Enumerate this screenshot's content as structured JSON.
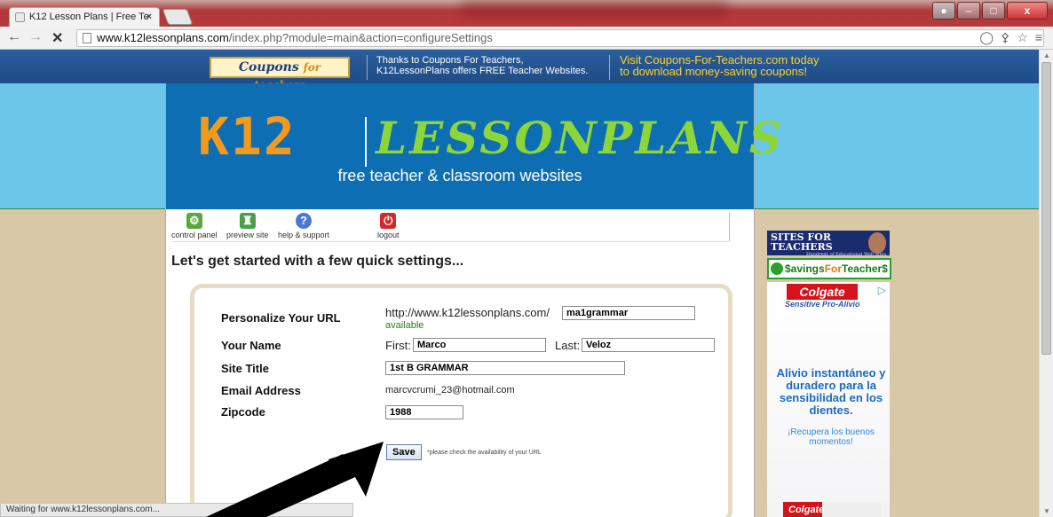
{
  "browser": {
    "tab_title": "K12 Lesson Plans | Free Te",
    "tab_close": "×",
    "url_host": "www.k12lessonplans.com",
    "url_path": "/index.php?module=main&action=configureSettings",
    "status_text": "Waiting for www.k12lessonplans.com..."
  },
  "topbar": {
    "coupon_logo_word1": "Coupons",
    "coupon_logo_word2": "for teachers",
    "message_line1": "Thanks to Coupons For Teachers,",
    "message_line2": "K12LessonPlans offers FREE Teacher Websites.",
    "promo_line1": "Visit Coupons-For-Teachers.com today",
    "promo_line2": "to download money-saving coupons!"
  },
  "banner": {
    "logo_k12": "K12",
    "logo_lessonplans": "LESSONPLANS",
    "tagline": "free teacher & classroom websites"
  },
  "nav": {
    "control_panel": "control panel",
    "preview_site": "preview site",
    "help_support": "help & support",
    "logout": "logout"
  },
  "heading": "Let's get started with a few quick settings...",
  "form": {
    "url_label": "Personalize Your URL",
    "url_prefix": "http://www.k12lessonplans.com/",
    "url_value": "ma1grammar",
    "url_status": "available",
    "name_label": "Your Name",
    "first_label": "First:",
    "first_value": "Marco",
    "last_label": "Last:",
    "last_value": "Veloz",
    "title_label": "Site Title",
    "title_value": "1st B GRAMMAR",
    "email_label": "Email Address",
    "email_value": "marcvcrumi_23@hotmail.com",
    "zip_label": "Zipcode",
    "zip_value": "1988",
    "save_label": "Save",
    "save_note": "*please check the availability of your URL"
  },
  "ads": {
    "sites_title": "SITES FOR TEACHERS",
    "sites_sub": "Hundreds of Educational Web Sites Rated by Popularity",
    "savings_a": "$avings",
    "savings_b": "For",
    "savings_c": "Teacher$",
    "colgate_logo": "Colgate",
    "colgate_sub": "Sensitive Pro-Alivio",
    "colgate_headline": "Alivio instantáneo y duradero para la sensibilidad en los dientes.",
    "colgate_cta": "¡Recupera los buenos momentos!",
    "colgate_pack": "Colgate"
  },
  "colors": {
    "topbar": "#1e4c86",
    "sky": "#6cc6ea",
    "banner": "#0e6eb4",
    "page_bg": "#d8c8a8",
    "logo_orange": "#f29a1e",
    "logo_green": "#8cd63a"
  }
}
